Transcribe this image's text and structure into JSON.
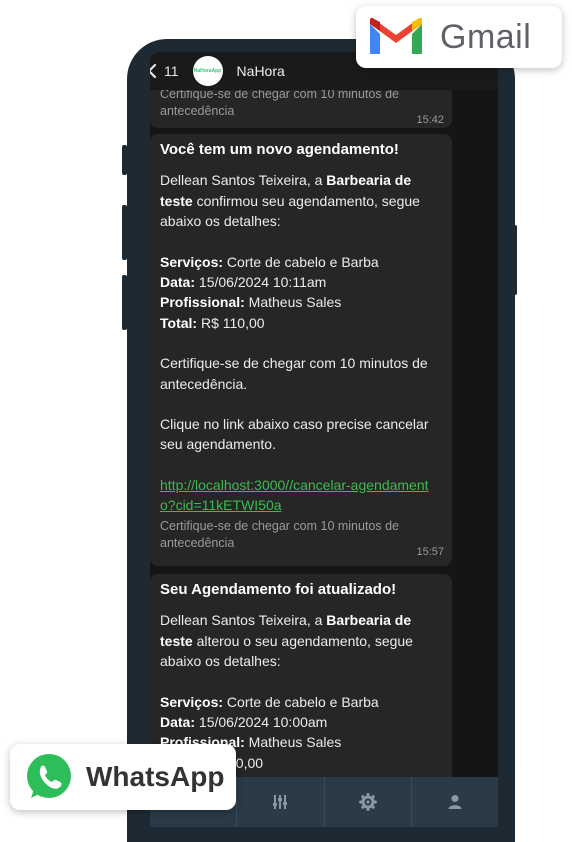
{
  "header": {
    "back_count": "11",
    "avatar_text": "NaHoraApp",
    "contact_name": "NaHora"
  },
  "messages": [
    {
      "footer": "Certifique-se de chegar com 10 minutos de antecedência",
      "time": "15:42"
    },
    {
      "title": "Você tem um novo agendamento!",
      "intro_name": "Dellean Santos Teixeira, a ",
      "intro_shop": "Barbearia de teste",
      "intro_rest": " confirmou seu agendamento, segue abaixo os detalhes:",
      "services_label": "Serviços:",
      "services_value": " Corte de cabelo e Barba",
      "date_label": "Data:",
      "date_value": " 15/06/2024  10:11am",
      "pro_label": "Profissional:",
      "pro_value": " Matheus Sales",
      "total_label": "Total:",
      "total_value": " R$ 110,00",
      "reminder": "Certifique-se de chegar com 10 minutos de antecedência.",
      "cancel_text": "Clique no link abaixo caso precise cancelar seu agendamento.",
      "link": "http://localhost:3000//cancelar-agendamento?cid=11kETWI50a",
      "footer": "Certifique-se de chegar com 10 minutos de antecedência",
      "time": "15:57"
    },
    {
      "title": "Seu Agendamento foi atualizado!",
      "intro_name": "Dellean Santos Teixeira, a ",
      "intro_shop": "Barbearia de teste",
      "intro_rest": " alterou o seu agendamento, segue abaixo os detalhes:",
      "services_label": "Serviços:",
      "services_value": " Corte de cabelo e Barba",
      "date_label": "Data:",
      "date_value": " 15/06/2024  10:00am",
      "pro_label": "Profissional:",
      "pro_value": " Matheus Sales",
      "total_value": "10,00"
    }
  ],
  "tabbar": {
    "icons": [
      "home-icon",
      "sliders-icon",
      "gear-icon",
      "person-icon"
    ]
  },
  "badges": {
    "gmail": "Gmail",
    "whatsapp": "WhatsApp"
  },
  "colors": {
    "link": "#3fb950",
    "bubble": "#262626",
    "tabbar": "#2a3a46",
    "phone": "#1e2a33"
  }
}
